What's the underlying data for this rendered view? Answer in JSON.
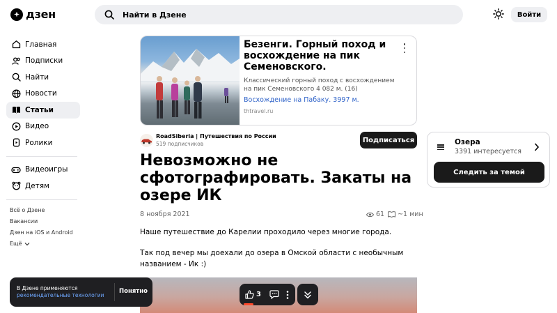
{
  "header": {
    "logo_text": "дзен",
    "search_placeholder": "Найти в Дзене",
    "login_label": "Войти",
    "theme_icon": "sun-icon"
  },
  "sidebar": {
    "items": [
      {
        "label": "Главная",
        "icon": "home-icon"
      },
      {
        "label": "Подписки",
        "icon": "subscriptions-icon"
      },
      {
        "label": "Найти",
        "icon": "search-icon"
      },
      {
        "label": "Новости",
        "icon": "globe-icon"
      },
      {
        "label": "Статьи",
        "icon": "articles-icon",
        "active": true
      },
      {
        "label": "Видео",
        "icon": "video-icon"
      },
      {
        "label": "Ролики",
        "icon": "shorts-icon"
      }
    ],
    "extra_items": [
      {
        "label": "Видеоигры",
        "icon": "gamepad-icon"
      },
      {
        "label": "Детям",
        "icon": "kids-icon"
      }
    ],
    "footer_links": [
      "Всё о Дзене",
      "Вакансии",
      "Дзен на iOS и Android",
      "Ещё"
    ]
  },
  "ad": {
    "title": "Безенги. Горный поход и восхождение на пик Семеновского.",
    "description": "Классический горный поход с восхождением на пик Семеновского 4 082 м. (16)",
    "link_text": "Восхождение на Пабаку. 3997 м.",
    "domain": "thtravel.ru"
  },
  "channel": {
    "name": "RoadSiberia | Путешествия по России",
    "subscribers": "519 подписчиков",
    "subscribe_label": "Подписаться"
  },
  "article": {
    "title": "Невозможно не сфотографировать. Закаты на озере ИК",
    "date": "8 ноября 2021",
    "views": "61",
    "read_time": "~1 мин",
    "paragraphs": [
      "Наше путешествие до Карелии проходило через многие города.",
      "Так под вечер мы доехали до озера в Омской области с необычным названием - Ик :)"
    ]
  },
  "topic": {
    "name": "Озера",
    "interested": "3391 интересуется",
    "follow_label": "Следить за темой"
  },
  "toast": {
    "text": "В Дзене применяются",
    "link": "рекомендательные технологии",
    "ok_label": "Понятно"
  },
  "float_bar": {
    "likes": "3"
  },
  "colors": {
    "accent_link": "#2f63c9",
    "dark_button": "#1a1a1a",
    "like_indicator": "#ff4a2c"
  }
}
